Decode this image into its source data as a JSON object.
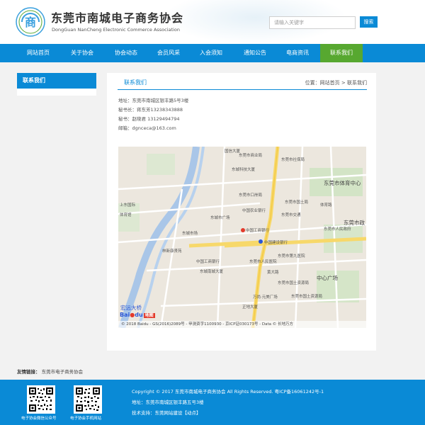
{
  "header": {
    "title": "东莞市南城电子商务协会",
    "subtitle": "DongGuan NanCheng Electronic Commerce Association",
    "logo_glyph": "商",
    "search_placeholder": "请输入关键字",
    "search_button": "搜索"
  },
  "nav": {
    "items": [
      {
        "label": "网站首页"
      },
      {
        "label": "关于协会"
      },
      {
        "label": "协会动态"
      },
      {
        "label": "会员风采"
      },
      {
        "label": "入会须知"
      },
      {
        "label": "通知公告"
      },
      {
        "label": "电商资讯"
      },
      {
        "label": "联系我们",
        "active": true
      }
    ]
  },
  "sidebar": {
    "title": "联系我们"
  },
  "content": {
    "title": "联系我们",
    "breadcrumb": "位置：网站首页 > 联系我们",
    "address": "地址：东莞市南城区银丰路5号3楼",
    "secretary": "秘书长：蒋东芳13238343888",
    "secretariat": "秘书：赵晓君 13129494794",
    "email": "邮箱：dgnceca@163.com"
  },
  "map": {
    "labels": [
      "国信大厦",
      "东莞市商业局",
      "东莞市社保局",
      "东城科技大厦",
      "东莞市体育中心",
      "东莞市口岸局",
      "东莞市国土局",
      "中国农业银行",
      "东莞市交通",
      "体育路",
      "东莞市政",
      "东莞市人民政府",
      "中国工商银行",
      "中国建设银行",
      "东莞市第九医院",
      "林新康贤苑",
      "中国工商银行",
      "东莞市人民医院",
      "黄大路",
      "东城南城大厦",
      "中心广场",
      "东莞市国土资源局",
      "万尚·元美厂场",
      "东莞市国土资源局",
      "正地大厦",
      "宏远大桥",
      "东城市场",
      "上东国际",
      "东城市广场",
      "体育馆"
    ],
    "copyright": "© 2018 Baidu - GS(2016)2089号 - 甲测资字1100930 - 京ICP证030173号 - Data © 长地万方",
    "logo_text": "Bai",
    "logo_text2": "du",
    "logo_map_word": "地图"
  },
  "links": {
    "label": "友情链接：",
    "item": "东莞市电子商务协会"
  },
  "footer": {
    "copyright": "Copyright © 2017 东莞市南城电子商务协会 All Rights Reserved.   粤ICP备16061242号-1",
    "address": "地址：东莞市南城区银丰路五号3楼",
    "support": "技术支持：东莞网站建设【动点】",
    "qr1_caption": "电子协会微信公众号",
    "qr2_caption": "电子协会手机网站"
  },
  "colors": {
    "primary": "#0a8ad6",
    "active_nav": "#57a830"
  }
}
